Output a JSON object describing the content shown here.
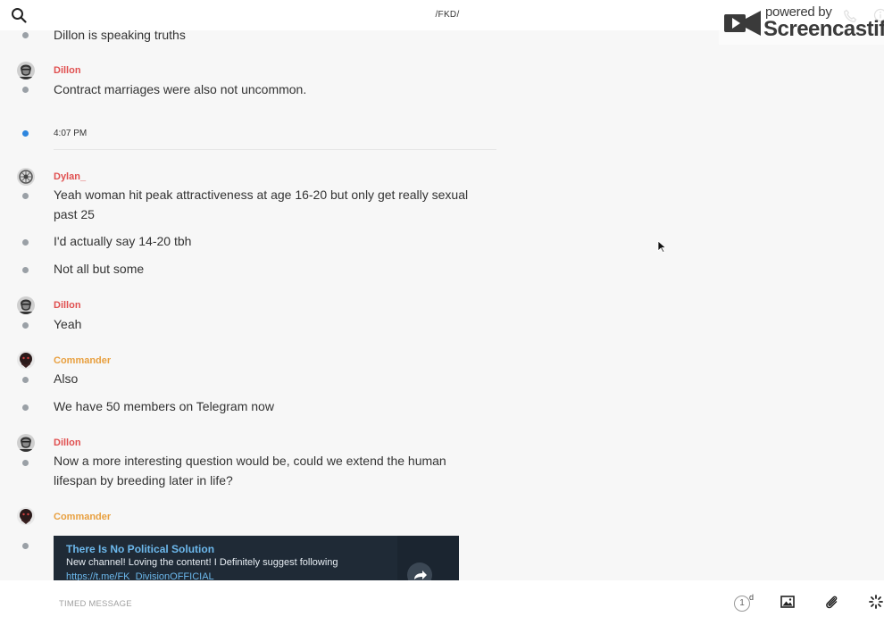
{
  "header": {
    "title": "/FKD/",
    "search_icon": "search-icon",
    "phone_icon": "phone-icon",
    "info_icon": "info-icon"
  },
  "watermark": {
    "line1": "powered by",
    "line2": "Screencastify"
  },
  "messages": [
    {
      "text": "Dillon is speaking truths"
    },
    {
      "sender": "Dillon",
      "text": "Contract marriages were also not uncommon."
    },
    {
      "time": "4:07 PM"
    },
    {
      "sender": "Dylan_",
      "text": "Yeah woman hit peak attractiveness at age 16-20 but only get really sexual past 25"
    },
    {
      "text": "I'd actually say 14-20 tbh"
    },
    {
      "text": "Not all but some"
    },
    {
      "sender": "Dillon",
      "text": "Yeah"
    },
    {
      "sender": "Commander",
      "text": "Also"
    },
    {
      "text": "We have 50 members on Telegram now"
    },
    {
      "sender": "Dillon",
      "text": "Now a more interesting question would be, could we extend the human lifespan by breeding later in life?"
    },
    {
      "sender": "Commander"
    }
  ],
  "forwarded_card": {
    "title": "There Is No Political Solution",
    "text": "New channel! Loving the content! I Definitely suggest following",
    "link": "https://t.me/FK_DivisionOFFICIAL"
  },
  "composer": {
    "placeholder": "TIMED MESSAGE",
    "timer_value": "1",
    "timer_unit": "d"
  },
  "colors": {
    "sender_red": "#e05050",
    "sender_orange": "#e8a040",
    "time_dot": "#2e86de",
    "card_bg": "#1f2a36",
    "card_title": "#6cb8ec"
  }
}
